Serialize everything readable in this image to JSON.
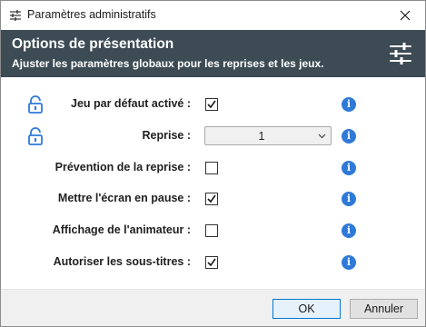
{
  "window": {
    "title": "Paramètres administratifs"
  },
  "header": {
    "title": "Options de présentation",
    "subtitle": "Ajuster les paramètres globaux pour les reprises et les jeux.",
    "icon": "settings-sliders-icon"
  },
  "rows": [
    {
      "label": "Jeu par défaut activé :",
      "control": "checkbox",
      "checked": true,
      "lock": true
    },
    {
      "label": "Reprise :",
      "control": "select",
      "value": "1",
      "lock": true
    },
    {
      "label": "Prévention de la reprise :",
      "control": "checkbox",
      "checked": false,
      "lock": false
    },
    {
      "label": "Mettre l'écran en pause :",
      "control": "checkbox",
      "checked": true,
      "lock": false
    },
    {
      "label": "Affichage de l'animateur :",
      "control": "checkbox",
      "checked": false,
      "lock": false
    },
    {
      "label": "Autoriser les sous-titres :",
      "control": "checkbox",
      "checked": true,
      "lock": false
    }
  ],
  "info_glyph": "i",
  "buttons": {
    "ok": "OK",
    "cancel": "Annuler"
  },
  "colors": {
    "header_bg": "#3c4b54",
    "lock": "#2f7ad8",
    "info": "#2f7ad8",
    "ok_border": "#0078d7"
  }
}
